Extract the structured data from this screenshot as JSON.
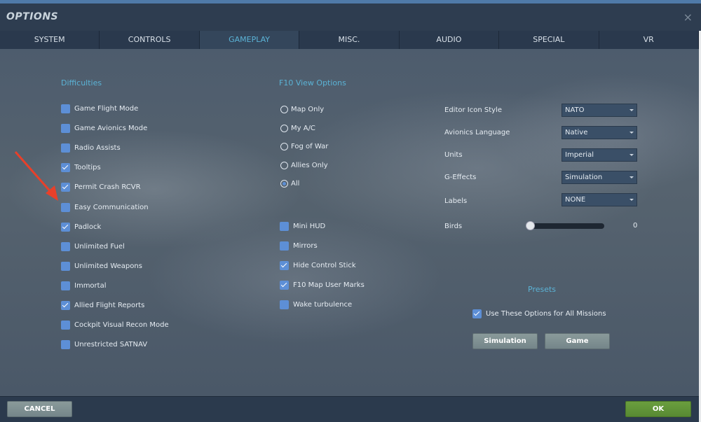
{
  "window": {
    "title": "OPTIONS",
    "close_icon": "×"
  },
  "tabs": [
    "SYSTEM",
    "CONTROLS",
    "GAMEPLAY",
    "MISC.",
    "AUDIO",
    "SPECIAL",
    "VR"
  ],
  "active_tab": "GAMEPLAY",
  "difficulties": {
    "heading": "Difficulties",
    "items": [
      {
        "label": "Game Flight Mode",
        "checked": false
      },
      {
        "label": "Game Avionics Mode",
        "checked": false
      },
      {
        "label": "Radio Assists",
        "checked": false
      },
      {
        "label": "Tooltips",
        "checked": true
      },
      {
        "label": "Permit Crash RCVR",
        "checked": true
      },
      {
        "label": "Easy Communication",
        "checked": false
      },
      {
        "label": "Padlock",
        "checked": true
      },
      {
        "label": "Unlimited Fuel",
        "checked": false
      },
      {
        "label": "Unlimited Weapons",
        "checked": false
      },
      {
        "label": "Immortal",
        "checked": false
      },
      {
        "label": "Allied Flight Reports",
        "checked": true
      },
      {
        "label": "Cockpit Visual Recon Mode",
        "checked": false
      },
      {
        "label": "Unrestricted SATNAV",
        "checked": false
      }
    ]
  },
  "f10": {
    "heading": "F10 View Options",
    "options": [
      "Map Only",
      "My A/C",
      "Fog of War",
      "Allies Only",
      "All"
    ],
    "selected": "All"
  },
  "misc_checks": [
    {
      "label": "Mini HUD",
      "checked": false
    },
    {
      "label": "Mirrors",
      "checked": false
    },
    {
      "label": "Hide Control Stick",
      "checked": true
    },
    {
      "label": "F10 Map User Marks",
      "checked": true
    },
    {
      "label": "Wake turbulence",
      "checked": false
    }
  ],
  "settings": [
    {
      "label": "Editor Icon Style",
      "value": "NATO"
    },
    {
      "label": "Avionics Language",
      "value": "Native"
    },
    {
      "label": "Units",
      "value": "Imperial"
    },
    {
      "label": "G-Effects",
      "value": "Simulation"
    },
    {
      "label": "Labels",
      "value": "NONE"
    }
  ],
  "birds": {
    "label": "Birds",
    "value": "0",
    "fraction": 0
  },
  "presets": {
    "heading": "Presets",
    "use_all": {
      "label": "Use These Options for All Missions",
      "checked": true
    },
    "buttons": [
      "Simulation",
      "Game"
    ]
  },
  "footer": {
    "cancel": "CANCEL",
    "ok": "OK"
  },
  "colors": {
    "accent": "#5bb3d6",
    "checkbox": "#5d8fd6",
    "ok": "#6a9e3e",
    "annotation_arrow": "#e8402a"
  }
}
